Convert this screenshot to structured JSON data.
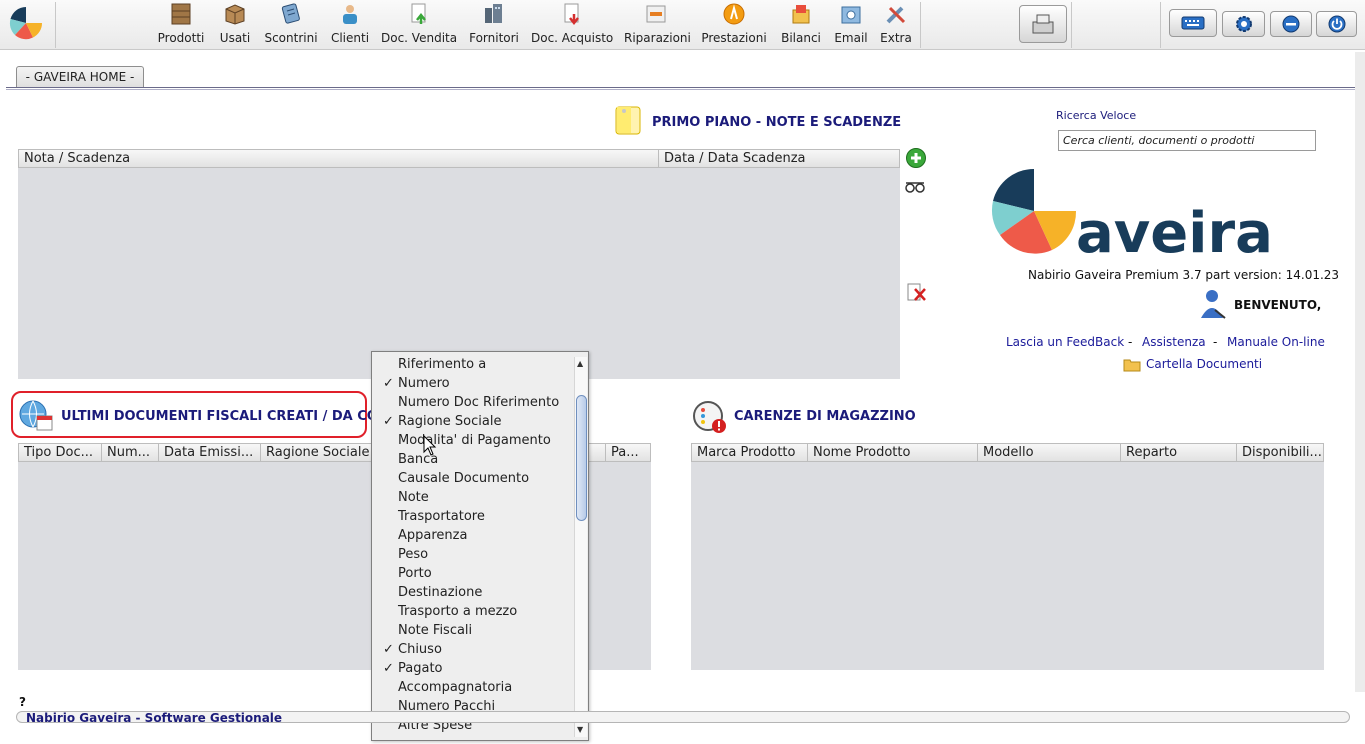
{
  "toolbar": {
    "items": [
      {
        "label": "Prodotti",
        "icon": "boxes-icon"
      },
      {
        "label": "Usati",
        "icon": "box-icon"
      },
      {
        "label": "Scontrini",
        "icon": "receipt-icon"
      },
      {
        "label": "Clienti",
        "icon": "client-icon"
      },
      {
        "label": "Doc. Vendita",
        "icon": "sales-doc-icon"
      },
      {
        "label": "Fornitori",
        "icon": "suppliers-icon"
      },
      {
        "label": "Doc. Acquisto",
        "icon": "purchase-doc-icon"
      },
      {
        "label": "Riparazioni",
        "icon": "repair-icon"
      },
      {
        "label": "Prestazioni",
        "icon": "service-icon"
      },
      {
        "label": "Bilanci",
        "icon": "balance-icon"
      },
      {
        "label": "Email",
        "icon": "email-icon"
      },
      {
        "label": "Extra",
        "icon": "extra-icon"
      }
    ]
  },
  "tabs": {
    "home": "- GAVEIRA HOME -"
  },
  "primo_piano": {
    "title": "PRIMO PIANO  -  NOTE E SCADENZE",
    "columns": [
      "Nota / Scadenza",
      "Data / Data Scadenza"
    ]
  },
  "documenti": {
    "title": "ULTIMI DOCUMENTI FISCALI CREATI / DA COMP",
    "columns": [
      "Tipo Doc...",
      "Num...",
      "Data Emissi...",
      "Ragione Sociale",
      "",
      "Pa..."
    ]
  },
  "carenze": {
    "title": "CARENZE DI MAGAZZINO",
    "columns": [
      "Marca Prodotto",
      "Nome Prodotto",
      "Modello",
      "Reparto",
      "Disponibili..."
    ]
  },
  "search": {
    "label": "Ricerca Veloce",
    "placeholder": "Cerca clienti, documenti o prodotti"
  },
  "brand": {
    "logo_text": "aveira",
    "version": "Nabirio Gaveira Premium 3.7 part version: 14.01.23",
    "welcome": "BENVENUTO,",
    "link_feedback": "Lascia un FeedBack",
    "link_assistenza": "Assistenza",
    "link_manuale": "Manuale On-line",
    "link_cartella": "Cartella Documenti",
    "sep": "-"
  },
  "popup_menu": {
    "items": [
      {
        "label": "Riferimento a",
        "checked": false
      },
      {
        "label": "Numero",
        "checked": true
      },
      {
        "label": "Numero Doc Riferimento",
        "checked": false
      },
      {
        "label": "Ragione Sociale",
        "checked": true
      },
      {
        "label": "Modalita' di Pagamento",
        "checked": false
      },
      {
        "label": "Banca",
        "checked": false
      },
      {
        "label": "Causale Documento",
        "checked": false
      },
      {
        "label": "Note",
        "checked": false
      },
      {
        "label": "Trasportatore",
        "checked": false
      },
      {
        "label": "Apparenza",
        "checked": false
      },
      {
        "label": "Peso",
        "checked": false
      },
      {
        "label": "Porto",
        "checked": false
      },
      {
        "label": "Destinazione",
        "checked": false
      },
      {
        "label": "Trasporto a mezzo",
        "checked": false
      },
      {
        "label": "Note Fiscali",
        "checked": false
      },
      {
        "label": "Chiuso",
        "checked": true
      },
      {
        "label": "Pagato",
        "checked": true
      },
      {
        "label": "Accompagnatoria",
        "checked": false
      },
      {
        "label": "Numero Pacchi",
        "checked": false
      },
      {
        "label": "Altre Spese",
        "checked": false
      }
    ],
    "check_glyph": "✓"
  },
  "status": {
    "help": "?",
    "text": "Nabirio Gaveira - Software Gestionale"
  },
  "colors": {
    "accent": "#1b1b7a",
    "logo_navy": "#183c5a",
    "logo_teal": "#7ecfcf",
    "logo_coral": "#ee5a49",
    "logo_yellow": "#f6b228"
  }
}
